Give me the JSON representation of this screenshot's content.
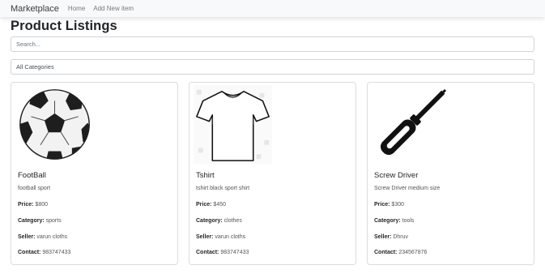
{
  "navbar": {
    "brand": "Marketplace",
    "links": [
      "Home",
      "Add New item"
    ]
  },
  "page_title": "Product Listings",
  "search": {
    "placeholder": "Search..."
  },
  "category_filter": {
    "selected": "All Categories"
  },
  "labels": {
    "price": "Price:",
    "category": "Category:",
    "seller": "Seller:",
    "contact": "Contact:"
  },
  "products": [
    {
      "name": "FootBall",
      "description": "football sport",
      "price": "$800",
      "category": "sports",
      "seller": "varun cloths",
      "contact": "983747433",
      "image_icon": "soccer-ball-icon"
    },
    {
      "name": "Tshirt",
      "description": "tshirt black sport shirt",
      "price": "$450",
      "category": "clothes",
      "seller": "varun cloths",
      "contact": "983747433",
      "image_icon": "tshirt-icon"
    },
    {
      "name": "Screw Driver",
      "description": "Screw Driver medium size",
      "price": "$300",
      "category": "tools",
      "seller": "Dhruv",
      "contact": "234567876",
      "image_icon": "screwdriver-icon"
    }
  ]
}
